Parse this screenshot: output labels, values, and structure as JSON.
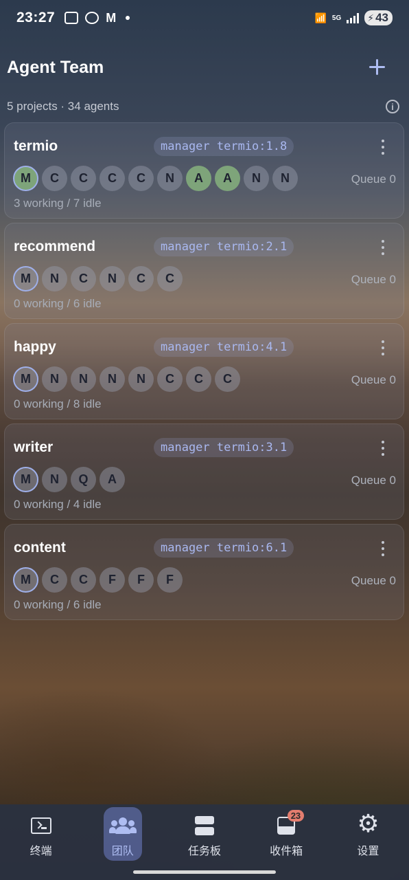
{
  "status_bar": {
    "time": "23:27",
    "network": "5G",
    "battery": "43"
  },
  "header": {
    "title": "Agent Team",
    "add_icon": "plus-icon"
  },
  "summary": {
    "text": "5 projects · 34 agents",
    "info_icon": "info-icon"
  },
  "projects": [
    {
      "name": "termio",
      "manager": "manager termio:1.8",
      "queue": "Queue 0",
      "status": "3 working / 7 idle",
      "agents": [
        {
          "label": "M",
          "state": "working",
          "role": "manager"
        },
        {
          "label": "C",
          "state": "idle"
        },
        {
          "label": "C",
          "state": "idle"
        },
        {
          "label": "C",
          "state": "idle"
        },
        {
          "label": "C",
          "state": "idle"
        },
        {
          "label": "N",
          "state": "idle"
        },
        {
          "label": "A",
          "state": "working"
        },
        {
          "label": "A",
          "state": "working"
        },
        {
          "label": "N",
          "state": "idle"
        },
        {
          "label": "N",
          "state": "idle"
        }
      ]
    },
    {
      "name": "recommend",
      "manager": "manager termio:2.1",
      "queue": "Queue 0",
      "status": "0 working / 6 idle",
      "agents": [
        {
          "label": "M",
          "state": "idle",
          "role": "manager"
        },
        {
          "label": "N",
          "state": "idle"
        },
        {
          "label": "C",
          "state": "idle"
        },
        {
          "label": "N",
          "state": "idle"
        },
        {
          "label": "C",
          "state": "idle"
        },
        {
          "label": "C",
          "state": "idle"
        }
      ]
    },
    {
      "name": "happy",
      "manager": "manager termio:4.1",
      "queue": "Queue 0",
      "status": "0 working / 8 idle",
      "agents": [
        {
          "label": "M",
          "state": "idle",
          "role": "manager"
        },
        {
          "label": "N",
          "state": "idle"
        },
        {
          "label": "N",
          "state": "idle"
        },
        {
          "label": "N",
          "state": "idle"
        },
        {
          "label": "N",
          "state": "idle"
        },
        {
          "label": "C",
          "state": "idle"
        },
        {
          "label": "C",
          "state": "idle"
        },
        {
          "label": "C",
          "state": "idle"
        }
      ]
    },
    {
      "name": "writer",
      "manager": "manager termio:3.1",
      "queue": "Queue 0",
      "status": "0 working / 4 idle",
      "agents": [
        {
          "label": "M",
          "state": "idle",
          "role": "manager"
        },
        {
          "label": "N",
          "state": "idle"
        },
        {
          "label": "Q",
          "state": "idle"
        },
        {
          "label": "A",
          "state": "idle"
        }
      ]
    },
    {
      "name": "content",
      "manager": "manager termio:6.1",
      "queue": "Queue 0",
      "status": "0 working / 6 idle",
      "agents": [
        {
          "label": "M",
          "state": "idle",
          "role": "manager"
        },
        {
          "label": "C",
          "state": "idle"
        },
        {
          "label": "C",
          "state": "idle"
        },
        {
          "label": "F",
          "state": "idle"
        },
        {
          "label": "F",
          "state": "idle"
        },
        {
          "label": "F",
          "state": "idle"
        }
      ]
    }
  ],
  "bottom_nav": [
    {
      "label": "终端",
      "icon": "terminal-icon",
      "active": false
    },
    {
      "label": "团队",
      "icon": "team-icon",
      "active": true
    },
    {
      "label": "任务板",
      "icon": "board-icon",
      "active": false
    },
    {
      "label": "收件箱",
      "icon": "inbox-icon",
      "active": false,
      "badge": "23"
    },
    {
      "label": "设置",
      "icon": "gear-icon",
      "active": false
    }
  ],
  "colors": {
    "accent": "#aebdf2",
    "working": "#7ea47a",
    "badge": "#e37d6f"
  }
}
